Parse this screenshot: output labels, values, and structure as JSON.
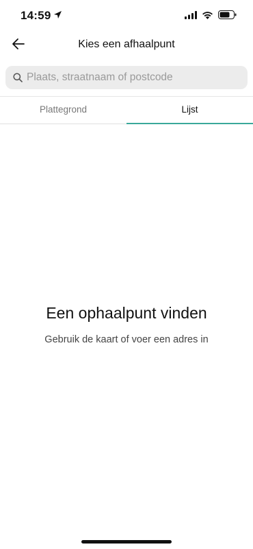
{
  "status_bar": {
    "time": "14:59",
    "icons": [
      "location-arrow-icon",
      "signal-icon",
      "wifi-icon",
      "battery-icon"
    ]
  },
  "header": {
    "title": "Kies een afhaalpunt",
    "back_icon": "arrow-left-icon"
  },
  "search": {
    "placeholder": "Plaats, straatnaam of postcode",
    "value": "",
    "icon": "search-icon"
  },
  "tabs": [
    {
      "label": "Plattegrond",
      "active": false
    },
    {
      "label": "Lijst",
      "active": true
    }
  ],
  "empty_state": {
    "title": "Een ophaalpunt vinden",
    "subtitle": "Gebruik de kaart of voer een adres in"
  },
  "colors": {
    "accent": "#3aa89a",
    "search_bg": "#ececec",
    "text_primary": "#111111",
    "text_secondary": "#777777"
  }
}
